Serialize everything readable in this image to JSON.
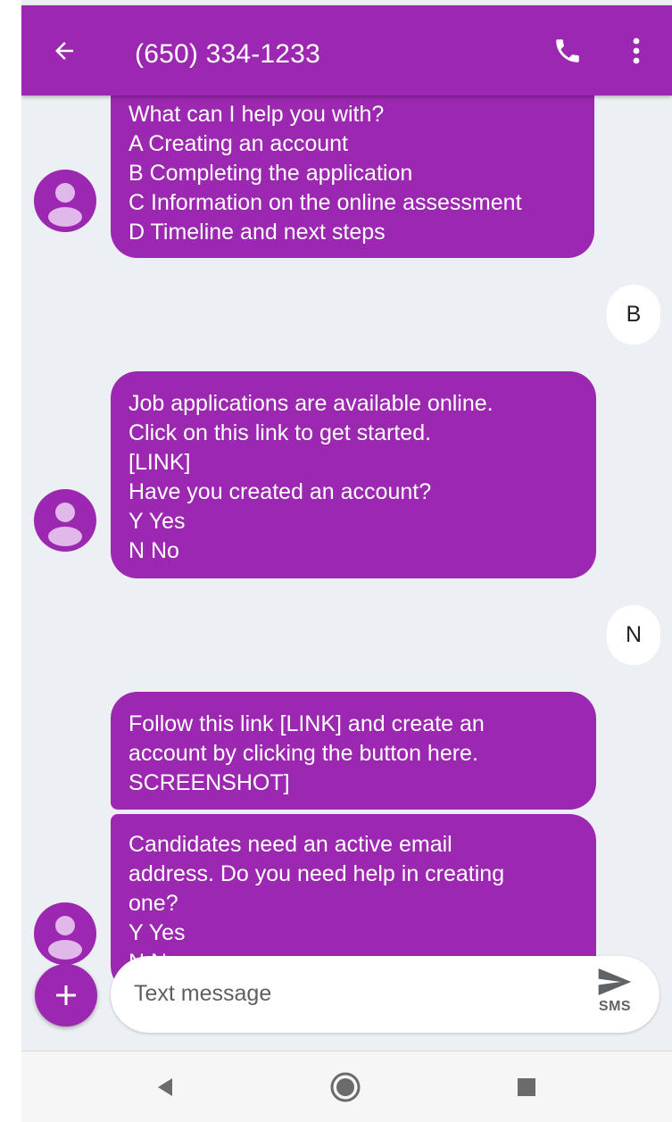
{
  "header": {
    "title": "(650) 334-1233",
    "back_icon": "arrow-left-icon",
    "call_icon": "phone-icon",
    "menu_icon": "more-vert-icon"
  },
  "messages": [
    {
      "type": "incoming",
      "lines": [
        "What can I help you with?",
        "A Creating an account",
        "B Completing the application",
        "C Information on the online assessment",
        "D Timeline and next steps"
      ]
    },
    {
      "type": "outgoing",
      "text": "B"
    },
    {
      "type": "incoming",
      "lines": [
        "Job applications are available online.",
        "Click on this link to get started.",
        "[LINK]",
        "Have you created an account?",
        "Y Yes",
        "N No"
      ]
    },
    {
      "type": "outgoing",
      "text": "N"
    },
    {
      "type": "incoming",
      "lines": [
        "Follow this link [LINK] and create an",
        "account by clicking the button here.",
        "SCREENSHOT]"
      ]
    },
    {
      "type": "incoming",
      "lines": [
        "Candidates need an active email",
        "address. Do you need help in creating",
        "one?",
        "Y Yes",
        "N No"
      ]
    }
  ],
  "composer": {
    "placeholder": "Text message",
    "send_label": "SMS",
    "add_icon": "plus-icon",
    "send_icon": "send-icon"
  },
  "colors": {
    "accent": "#9c27b0",
    "background": "#eceff3",
    "bubble_text": "#ffffff"
  }
}
